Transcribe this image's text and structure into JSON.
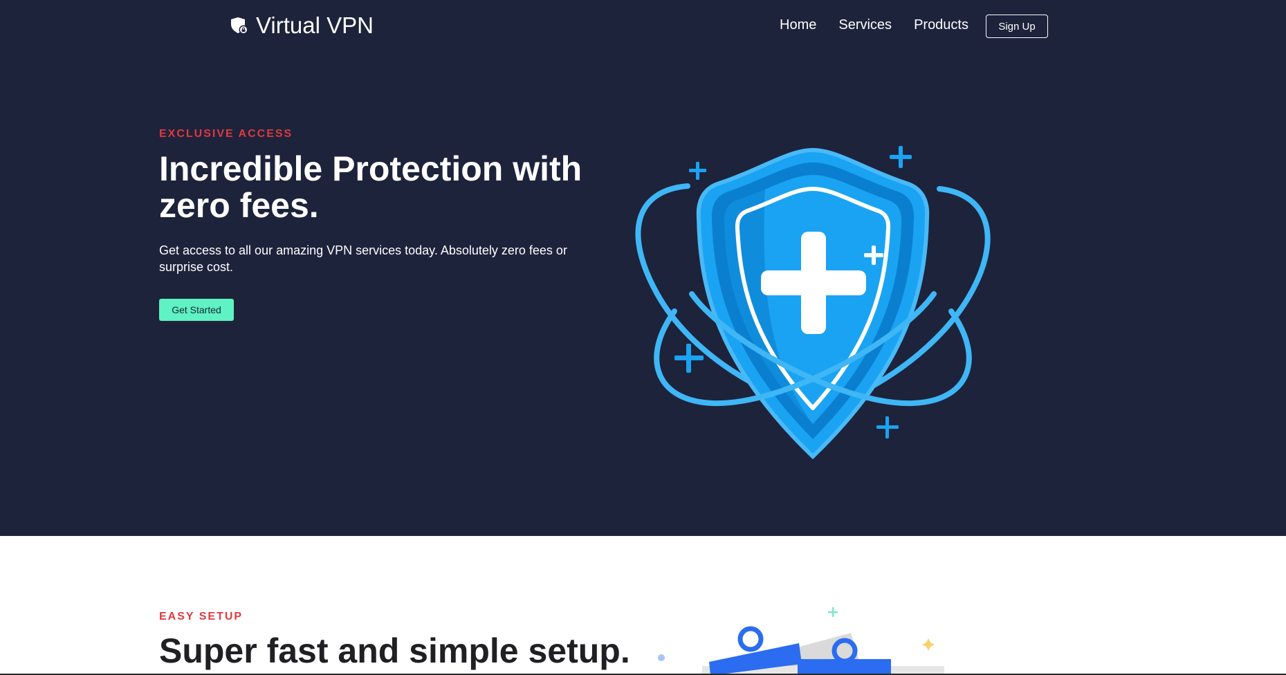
{
  "navbar": {
    "brand": {
      "icon": "shield-lock-icon",
      "name": "Virtual VPN"
    },
    "links": [
      {
        "label": "Home"
      },
      {
        "label": "Services"
      },
      {
        "label": "Products"
      }
    ],
    "signup_label": "Sign Up"
  },
  "hero": {
    "eyebrow": "EXCLUSIVE ACCESS",
    "title": "Incredible Protection with zero fees.",
    "description": "Get access to all our amazing VPN services today. Absolutely zero fees or surprise cost.",
    "cta_label": "Get Started",
    "illustration": "shield-plus-orbit-illustration"
  },
  "setup": {
    "eyebrow": "EASY SETUP",
    "title": "Super fast and simple setup.",
    "illustration": "setup-cable-illustration"
  },
  "colors": {
    "hero_background": "#1d233b",
    "accent_red": "#e0393e",
    "cta_green": "#5ff2c2",
    "shield_blue": "#1aa3f2",
    "shield_dark_blue": "#0b7fcf"
  }
}
